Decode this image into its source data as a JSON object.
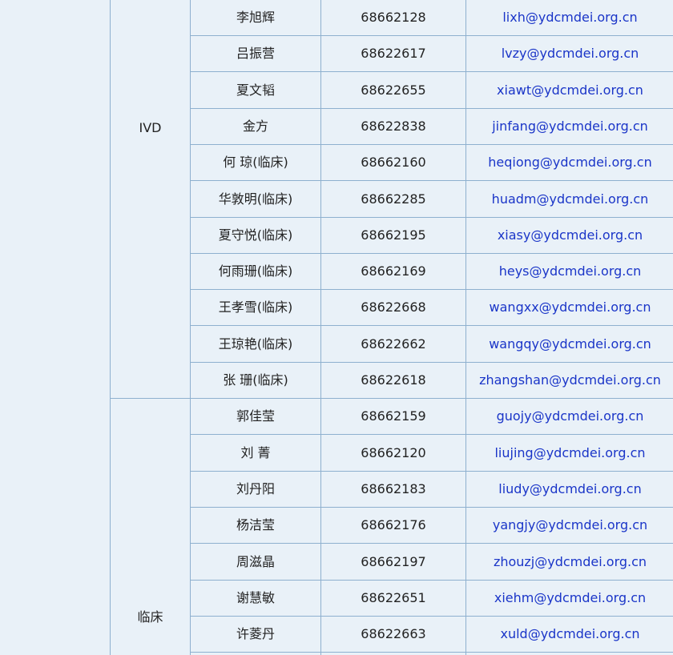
{
  "departments": [
    {
      "label": "IVD"
    },
    {
      "label": "临床"
    }
  ],
  "rows": [
    {
      "name": "李旭辉",
      "phone": "68662128",
      "email": "lixh@ydcmdei.org.cn"
    },
    {
      "name": "吕振营",
      "phone": "68622617",
      "email": "lvzy@ydcmdei.org.cn"
    },
    {
      "name": "夏文韬",
      "phone": "68622655",
      "email": "xiawt@ydcmdei.org.cn"
    },
    {
      "name": "金方",
      "phone": "68622838",
      "email": "jinfang@ydcmdei.org.cn"
    },
    {
      "name": "何  琼(临床)",
      "phone": "68662160",
      "email": "heqiong@ydcmdei.org.cn"
    },
    {
      "name": "华敦明(临床)",
      "phone": "68662285",
      "email": "huadm@ydcmdei.org.cn"
    },
    {
      "name": "夏守悦(临床)",
      "phone": "68662195",
      "email": "xiasy@ydcmdei.org.cn"
    },
    {
      "name": "何雨珊(临床)",
      "phone": "68662169",
      "email": "heys@ydcmdei.org.cn"
    },
    {
      "name": "王孝雪(临床)",
      "phone": "68622668",
      "email": "wangxx@ydcmdei.org.cn"
    },
    {
      "name": "王琼艳(临床)",
      "phone": "68622662",
      "email": "wangqy@ydcmdei.org.cn"
    },
    {
      "name": "张  珊(临床)",
      "phone": "68622618",
      "email": "zhangshan@ydcmdei.org.cn"
    },
    {
      "name": "郭佳莹",
      "phone": "68662159",
      "email": "guojy@ydcmdei.org.cn"
    },
    {
      "name": "刘  菁",
      "phone": "68662120",
      "email": "liujing@ydcmdei.org.cn"
    },
    {
      "name": "刘丹阳",
      "phone": "68662183",
      "email": "liudy@ydcmdei.org.cn"
    },
    {
      "name": "杨洁莹",
      "phone": "68662176",
      "email": "yangjy@ydcmdei.org.cn"
    },
    {
      "name": "周滋晶",
      "phone": "68662197",
      "email": "zhouzj@ydcmdei.org.cn"
    },
    {
      "name": "谢慧敏",
      "phone": "68622651",
      "email": "xiehm@ydcmdei.org.cn"
    },
    {
      "name": "许菱丹",
      "phone": "68622663",
      "email": "xuld@ydcmdei.org.cn"
    }
  ]
}
